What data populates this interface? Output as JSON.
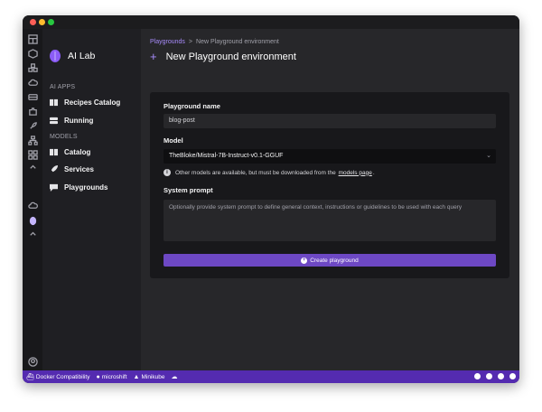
{
  "sidebar": {
    "brand": "AI Lab",
    "sections": [
      {
        "label": "AI APPS",
        "items": [
          {
            "label": "Recipes Catalog",
            "icon": "book-icon"
          },
          {
            "label": "Running",
            "icon": "server-icon"
          }
        ]
      },
      {
        "label": "MODELS",
        "items": [
          {
            "label": "Catalog",
            "icon": "book-icon"
          },
          {
            "label": "Services",
            "icon": "rocket-icon"
          },
          {
            "label": "Playgrounds",
            "icon": "chat-icon"
          }
        ]
      }
    ]
  },
  "breadcrumb": {
    "parent": "Playgrounds",
    "separator": ">",
    "current": "New Playground environment"
  },
  "page": {
    "title": "New Playground environment"
  },
  "form": {
    "name_label": "Playground name",
    "name_value": "blog-post",
    "model_label": "Model",
    "model_value": "TheBloke/Mistral-7B-Instruct-v0.1-GGUF",
    "hint_prefix": "Other models are available, but must be downloaded from the",
    "hint_link": "models page",
    "hint_suffix": ".",
    "prompt_label": "System prompt",
    "prompt_placeholder": "Optionally provide system prompt to define general context, instructions or guidelines to be used with each query",
    "create_label": "Create playground"
  },
  "statusbar": {
    "items": [
      {
        "label": "Docker Compatibility",
        "icon": "docker-icon"
      },
      {
        "label": "microshift",
        "icon": "microshift-icon"
      },
      {
        "label": "Minikube",
        "icon": "minikube-icon"
      }
    ]
  },
  "colors": {
    "accent": "#6d48c4",
    "statusbar": "#542bb0",
    "link": "#a78bfa"
  }
}
